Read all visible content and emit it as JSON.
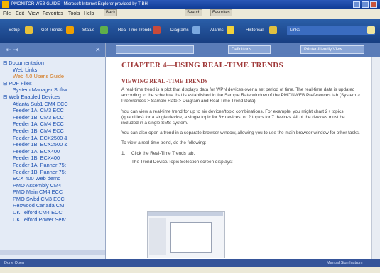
{
  "window": {
    "title": "PMONITOR WEB GUIDE - Microsoft Internet Explorer provided by TIBHI"
  },
  "menu": {
    "file": "File",
    "edit": "Edit",
    "view": "View",
    "favorites": "Favorites",
    "tools": "Tools",
    "help": "Help",
    "back": "Back",
    "search": "Search",
    "favs": "Favorites"
  },
  "appbar": {
    "btn1": "Setup",
    "btn2": "Get Trends",
    "btn3": "Status",
    "btn4": "Real-Time Trends",
    "btn5": "Diagrams",
    "btn6": "Alarms",
    "btn7": "Historical",
    "btn8": "Links"
  },
  "leftnav": {
    "arrows": "⇤ ⇥",
    "close": "✕"
  },
  "tree": [
    {
      "label": "Documentation",
      "level": 0
    },
    {
      "label": "Web Links",
      "level": 1
    },
    {
      "label": "Web 4.0 User's Guide",
      "level": 2
    },
    {
      "label": "PDF Files",
      "level": 0
    },
    {
      "label": "System Manager Softw",
      "level": 1
    },
    {
      "label": "Web Enabled Devices",
      "level": 0
    },
    {
      "label": "Atlanta Sub1 CM4 ECC",
      "level": 1
    },
    {
      "label": "Feeder 1A, CM3 ECC",
      "level": 1
    },
    {
      "label": "Feeder 1B, CM3 ECC",
      "level": 1
    },
    {
      "label": "Feeder 1A, CM4 ECC",
      "level": 1
    },
    {
      "label": "Feeder 1B, CM4 ECC",
      "level": 1
    },
    {
      "label": "Feeder 1A, ECX2500 &",
      "level": 1
    },
    {
      "label": "Feeder 1B, ECX2500 &",
      "level": 1
    },
    {
      "label": "Feeder 1A, ECX400",
      "level": 1
    },
    {
      "label": "Feeder 1B, ECX400",
      "level": 1
    },
    {
      "label": "Feeder 1A, Panner 75t",
      "level": 1
    },
    {
      "label": "Feeder 1B, Panner 75t",
      "level": 1
    },
    {
      "label": "ECX 400 Web demo",
      "level": 1
    },
    {
      "label": "PMO Assembly CM4",
      "level": 1
    },
    {
      "label": "PMO Main CM4 ECC",
      "level": 1
    },
    {
      "label": "PMO Swbd CM3 ECC",
      "level": 1
    },
    {
      "label": "Rexwood Canada CM",
      "level": 1
    },
    {
      "label": "UK Telford CM4 ECC",
      "level": 1
    },
    {
      "label": "UK Telford Power Serv",
      "level": 1
    }
  ],
  "content": {
    "tabs": [
      "",
      "Definitions",
      "Printer-friendly View"
    ],
    "heading": "CHAPTER 4—USING REAL-TIME TRENDS",
    "subheading": "VIEWING REAL -TIME TRENDS",
    "p1": "A real-time trend is a plot that displays data for WPN devices over a set period of time. The real-time data is updated according to the schedule that is established in the Sample Rate window of the PMONWEB Preferences tab (System > Preferences > Sample Rate > Diagram and Real Time Trend Data).",
    "p2": "You can view a real-time trend for up to six devices/topic combinations. For example, you might chart 2+ topics (quantities) for a single device, a single topic for 8+ devices, or 2 topics for 7 devices. All of the devices must be included in a single SMS system.",
    "p3": "You can also open a trend in a separate browser window, allowing you to use the main browser window for other tasks.",
    "p4": "To view a real-time trend, do the following:",
    "step_num": "1.",
    "step_text": "Click the Real-Time Trends tab.",
    "step_sub": "The Trend Device/Topic Selection screen displays:"
  },
  "status": {
    "left": "Done  Open",
    "right": "Manual  Sign  Instrum"
  },
  "colors": {
    "accent": "#183f82",
    "heading": "#a03a3a",
    "link": "#1a4fb0",
    "highlight": "#d4781c"
  }
}
